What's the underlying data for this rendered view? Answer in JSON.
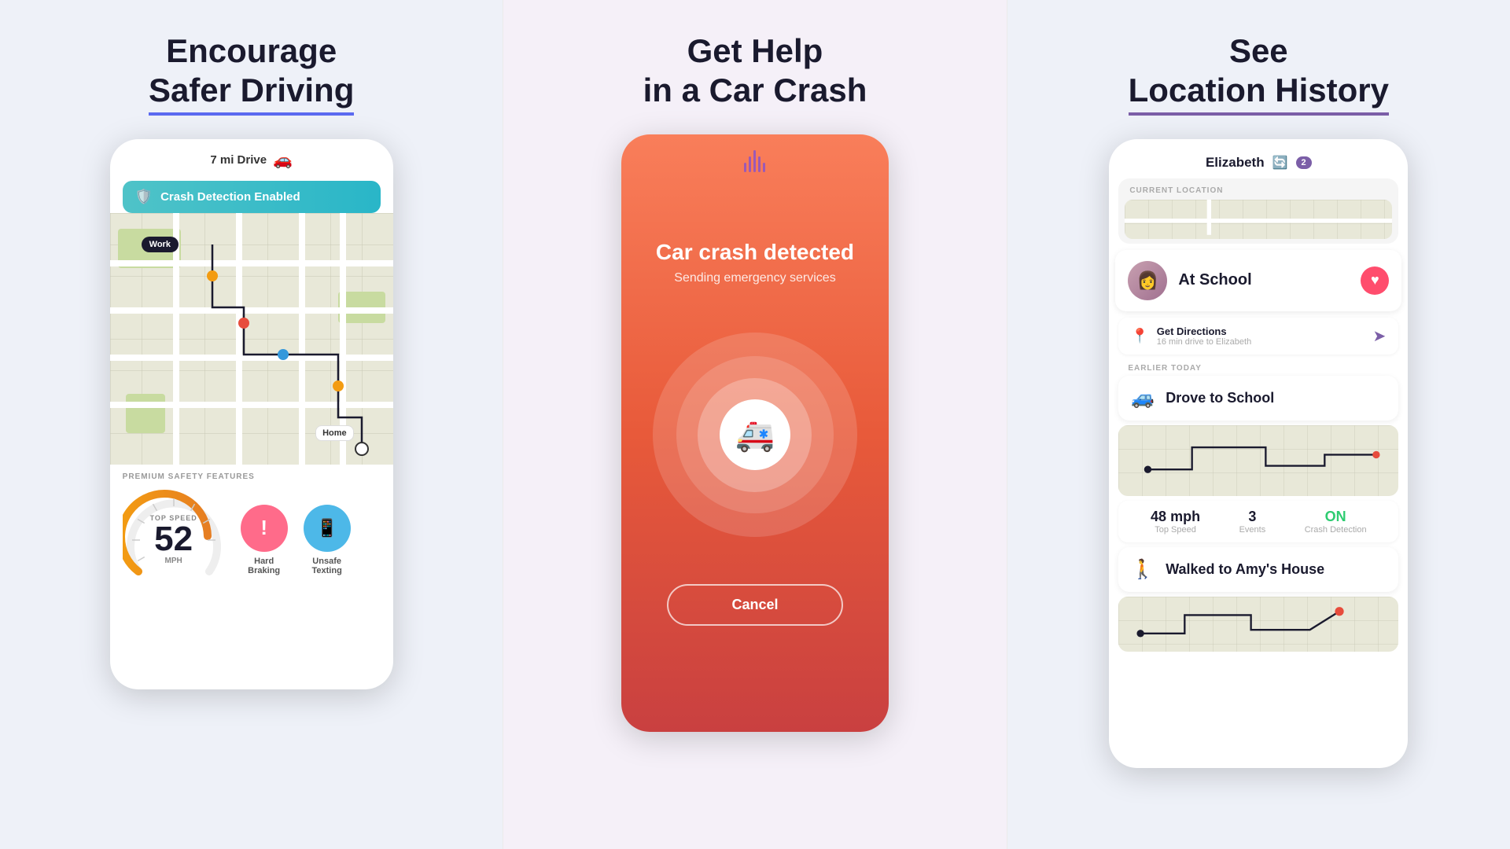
{
  "panels": [
    {
      "id": "left",
      "title_line1": "Encourage",
      "title_line2": "Safer Driving",
      "phone": {
        "drive_header": "7 mi Drive",
        "crash_detection": "Crash Detection Enabled",
        "work_label": "Work",
        "home_label": "Home",
        "premium_label": "PREMIUM SAFETY FEATURES",
        "top_speed_label": "TOP SPEED",
        "top_speed_value": "52",
        "top_speed_unit": "MPH",
        "hard_braking_label": "Hard\nBraking",
        "unsafe_texting_label": "Unsafe\nTexting"
      }
    },
    {
      "id": "center",
      "title_line1": "Get Help",
      "title_line2": "in a Car Crash",
      "phone": {
        "crash_title": "Car crash detected",
        "crash_subtitle": "Sending emergency services",
        "cancel_label": "Cancel"
      }
    },
    {
      "id": "right",
      "title_line1": "See",
      "title_line2": "Location History",
      "phone": {
        "user_name": "Elizabeth",
        "current_location_label": "CURRENT LOCATION",
        "at_school": "At School",
        "get_directions_label": "Get Directions",
        "get_directions_sub": "16 min drive to Elizabeth",
        "earlier_today": "EARLIER TODAY",
        "drove_to_school": "Drove to School",
        "top_speed_val": "48 mph",
        "top_speed_key": "Top Speed",
        "events_val": "3",
        "events_key": "Events",
        "crash_detection_val": "ON",
        "crash_detection_key": "Crash Detection",
        "walked_to_amys": "Walked to Amy's House",
        "notif_count": "2"
      }
    }
  ]
}
